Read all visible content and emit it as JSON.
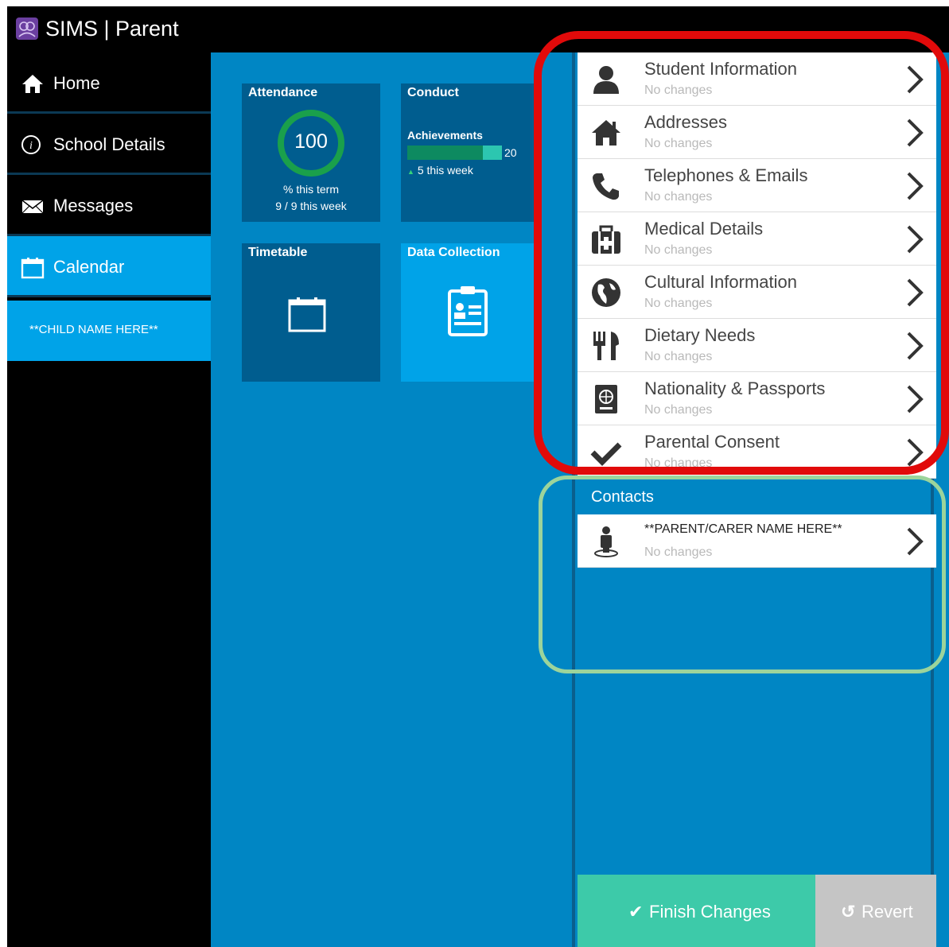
{
  "header": {
    "title": "SIMS | Parent"
  },
  "sidebar": {
    "items": [
      {
        "label": "Home",
        "icon": "home-icon"
      },
      {
        "label": "School Details",
        "icon": "info-icon"
      },
      {
        "label": "Messages",
        "icon": "envelope-icon"
      },
      {
        "label": "Calendar",
        "icon": "calendar-icon"
      }
    ],
    "child_name": "**CHILD NAME HERE**"
  },
  "tiles": {
    "attendance": {
      "title": "Attendance",
      "value": "100",
      "line1": "% this term",
      "line2": "9 / 9 this week",
      "ring_percent": 100
    },
    "conduct": {
      "title": "Conduct",
      "subtitle": "Achievements",
      "count": "20",
      "change": "5 this week",
      "bar_fraction": 0.8
    },
    "timetable": {
      "title": "Timetable",
      "icon": "calendar-icon"
    },
    "data_collection": {
      "title": "Data Collection",
      "icon": "clipboard-icon"
    }
  },
  "panel": {
    "rows": [
      {
        "label": "Student Information",
        "status": "No changes",
        "icon": "person-icon"
      },
      {
        "label": "Addresses",
        "status": "No changes",
        "icon": "house-icon"
      },
      {
        "label": "Telephones & Emails",
        "status": "No changes",
        "icon": "phone-icon"
      },
      {
        "label": "Medical Details",
        "status": "No changes",
        "icon": "medical-kit-icon"
      },
      {
        "label": "Cultural Information",
        "status": "No changes",
        "icon": "globe-icon"
      },
      {
        "label": "Dietary Needs",
        "status": "No changes",
        "icon": "fork-knife-icon"
      },
      {
        "label": "Nationality & Passports",
        "status": "No changes",
        "icon": "passport-icon"
      },
      {
        "label": "Parental Consent",
        "status": "No changes",
        "icon": "checkmark-icon"
      }
    ],
    "contacts_title": "Contacts",
    "contact": {
      "name": "**PARENT/CARER NAME HERE**",
      "status": "No changes",
      "icon": "contact-person-icon"
    },
    "finish_label": "Finish Changes",
    "revert_label": "Revert"
  },
  "colors": {
    "header_bg": "#000000",
    "content_bg": "#0086c4",
    "active_nav": "#00a3e8",
    "tile_dark": "#005d8f",
    "finish_button": "#3dcaa9",
    "revert_button": "#c5c5c5",
    "annotation_red": "#e10a0a",
    "annotation_green": "#9cd49b"
  }
}
